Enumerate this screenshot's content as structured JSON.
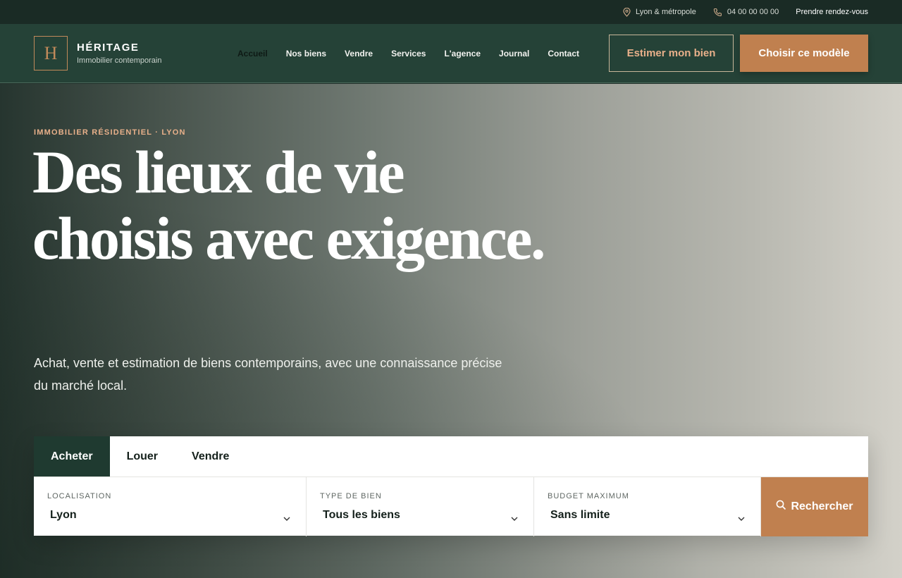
{
  "topbar": {
    "location": "Lyon & métropole",
    "phone": "04 00 00 00 00",
    "appointment": "Prendre rendez-vous"
  },
  "brand": {
    "monogram": "H",
    "name": "HÉRITAGE",
    "tagline": "Immobilier contemporain"
  },
  "nav": {
    "items": [
      "Accueil",
      "Nos biens",
      "Vendre",
      "Services",
      "L'agence",
      "Journal",
      "Contact"
    ]
  },
  "header_actions": {
    "estimate": "Estimer mon bien",
    "choose": "Choisir ce modèle"
  },
  "hero": {
    "eyebrow": "IMMOBILIER RÉSIDENTIEL · LYON",
    "headline": "Des lieux de vie choisis avec exigence.",
    "lede": "Achat, vente et estimation de biens contemporains, avec une connaissance précise du marché local."
  },
  "search": {
    "tabs": [
      "Acheter",
      "Louer",
      "Vendre"
    ],
    "active_tab": "Acheter",
    "location": {
      "label": "LOCALISATION",
      "value": "Lyon"
    },
    "type": {
      "label": "TYPE DE BIEN",
      "value": "Tous les biens"
    },
    "budget": {
      "label": "BUDGET MAXIMUM",
      "value": "Sans limite"
    },
    "submit": "Rechercher"
  },
  "colors": {
    "primary_green": "#254237",
    "accent_copper": "#c0804f",
    "accent_light": "#e8b08a"
  },
  "icons": {
    "location": "map-pin-icon",
    "phone": "phone-icon",
    "dropdown": "chevron-down-icon",
    "search": "search-icon"
  }
}
